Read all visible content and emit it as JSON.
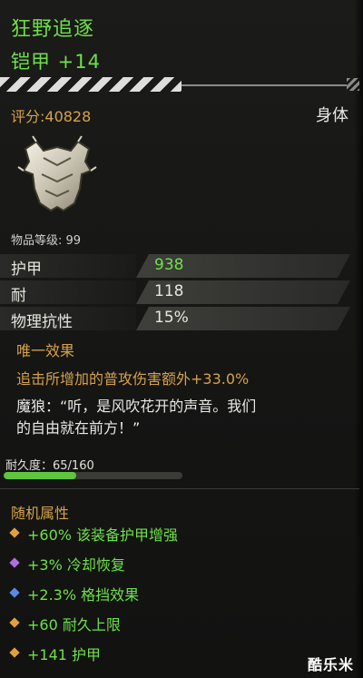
{
  "item": {
    "name": "狂野追逐",
    "type": "铠甲 +14",
    "score": "评分:40828",
    "slot": "身体",
    "icon": "armor-icon",
    "level": "物品等级: 99"
  },
  "stats": [
    {
      "name": "护甲",
      "value": "938",
      "color": "#6ee04a"
    },
    {
      "name": "耐",
      "value": "118",
      "color": "#e6e6e0"
    },
    {
      "name": "物理抗性",
      "value": "15%",
      "color": "#e6e6e0"
    }
  ],
  "unique": {
    "title": "唯一效果",
    "effect": "追击所增加的普攻伤害额外+33.0%"
  },
  "quote": {
    "line1": "魔狼：“听，是风吹花开的声音。我们",
    "line2": "的自由就在前方！”"
  },
  "durability": {
    "label": "耐久度：65/160",
    "current": 65,
    "max": 160
  },
  "random_attributes": {
    "title": "随机属性",
    "items": [
      {
        "text": "+60% 该装备护甲增强",
        "gem_color": "#e0a040"
      },
      {
        "text": "+3% 冷却恢复",
        "gem_color": "#b070e0"
      },
      {
        "text": "+2.3% 格挡效果",
        "gem_color": "#5a8ae0"
      },
      {
        "text": "+60 耐久上限",
        "gem_color": "#e0a040"
      },
      {
        "text": "+141 护甲",
        "gem_color": "#e0a040"
      }
    ]
  },
  "watermark": "酷乐米"
}
